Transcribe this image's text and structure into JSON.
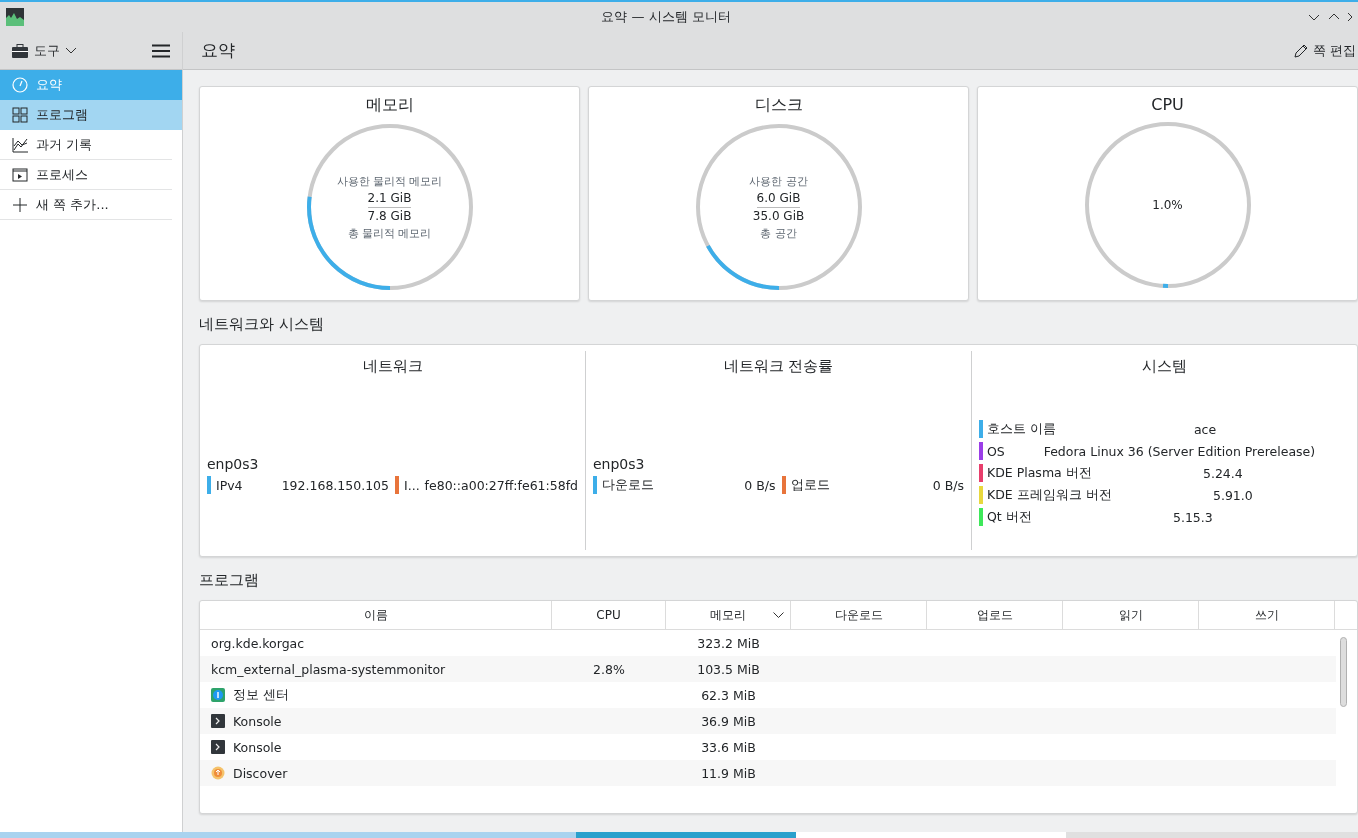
{
  "window": {
    "title": "요약 — 시스템 모니터"
  },
  "toolbar": {
    "menu_label": "도구",
    "page_title": "요약",
    "edit_button": "쪽 편집"
  },
  "sidebar": {
    "items": [
      {
        "label": "요약",
        "kind": "gauge",
        "selected": true,
        "hovered": false
      },
      {
        "label": "프로그램",
        "kind": "grid",
        "selected": false,
        "hovered": true
      },
      {
        "label": "과거 기록",
        "kind": "chart",
        "selected": false,
        "hovered": false
      },
      {
        "label": "프로세스",
        "kind": "process",
        "selected": false,
        "hovered": false
      },
      {
        "label": "새 쪽 추가...",
        "kind": "add",
        "selected": false,
        "hovered": false
      }
    ]
  },
  "gauges": [
    {
      "title": "메모리",
      "level": 0.27,
      "used_label": "사용한 물리적 메모리",
      "used": "2.1 GiB",
      "total": "7.8 GiB",
      "total_label": "총 물리적 메모리"
    },
    {
      "title": "디스크",
      "level": 0.17,
      "used_label": "사용한 공간",
      "used": "6.0 GiB",
      "total": "35.0 GiB",
      "total_label": "총 공간"
    },
    {
      "title": "CPU",
      "level": 0.01,
      "value": "1.0%"
    }
  ],
  "network_section": {
    "title": "네트워크와 시스템",
    "network": {
      "title": "네트워크",
      "interface": "enp0s3",
      "rows": [
        {
          "label": "IPv4",
          "value": "192.168.150.105",
          "color": "#3daee9"
        },
        {
          "label": "I...",
          "value": "fe80::a00:27ff:fe61:58fd",
          "color": "#e8743b"
        }
      ]
    },
    "transfer": {
      "title": "네트워크 전송률",
      "interface": "enp0s3",
      "rows": [
        {
          "label": "다운로드",
          "value": "0 B/s",
          "color": "#3daee9"
        },
        {
          "label": "업로드",
          "value": "0 B/s",
          "color": "#e8743b"
        }
      ]
    },
    "system": {
      "title": "시스템",
      "rows": [
        {
          "label": "호스트 이름",
          "value": "ace",
          "color": "#3daee9"
        },
        {
          "label": "OS",
          "value": "Fedora Linux 36 (Server Edition Prerelease)",
          "color": "#9b3ee8"
        },
        {
          "label": "KDE Plasma 버전",
          "value": "5.24.4",
          "color": "#e83e6c"
        },
        {
          "label": "KDE 프레임워크 버전",
          "value": "5.91.0",
          "color": "#e8d83e"
        },
        {
          "label": "Qt 버전",
          "value": "5.15.3",
          "color": "#3ee85a"
        }
      ]
    }
  },
  "programs": {
    "title": "프로그램",
    "columns": [
      {
        "label": "이름",
        "sorted": false
      },
      {
        "label": "CPU",
        "sorted": false
      },
      {
        "label": "메모리",
        "sorted": true
      },
      {
        "label": "다운로드",
        "sorted": false
      },
      {
        "label": "업로드",
        "sorted": false
      },
      {
        "label": "읽기",
        "sorted": false
      },
      {
        "label": "쓰기",
        "sorted": false
      }
    ],
    "rows": [
      {
        "kind": "none",
        "name": "org.kde.korgac",
        "memory": "323.2 MiB"
      },
      {
        "kind": "none",
        "name": "kcm_external_plasma-systemmonitor",
        "cpu": "2.8%",
        "memory": "103.5 MiB"
      },
      {
        "kind": "info",
        "name": "정보 센터",
        "memory": "62.3 MiB"
      },
      {
        "kind": "terminal",
        "name": "Konsole",
        "memory": "36.9 MiB"
      },
      {
        "kind": "terminal",
        "name": "Konsole",
        "memory": "33.6 MiB"
      },
      {
        "kind": "discover",
        "name": "Discover",
        "memory": "11.9 MiB"
      }
    ]
  }
}
